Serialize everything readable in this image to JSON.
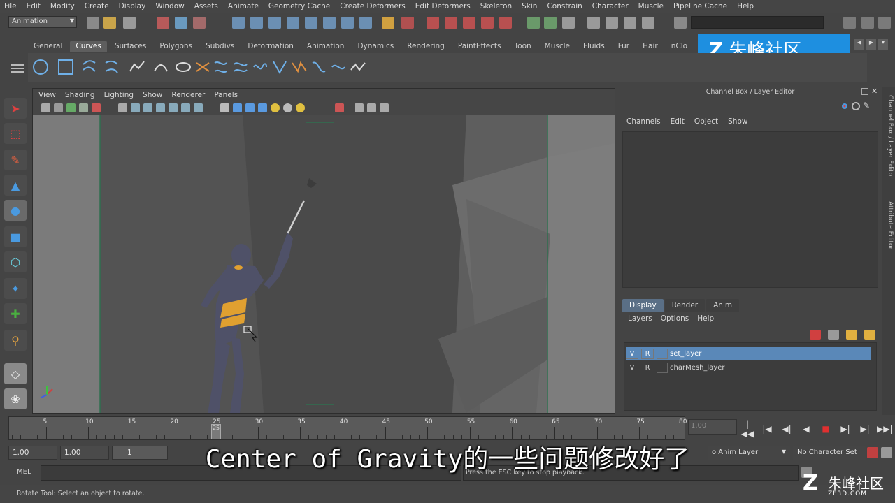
{
  "menu": [
    "File",
    "Edit",
    "Modify",
    "Create",
    "Display",
    "Window",
    "Assets",
    "Animate",
    "Geometry Cache",
    "Create Deformers",
    "Edit Deformers",
    "Skeleton",
    "Skin",
    "Constrain",
    "Character",
    "Muscle",
    "Pipeline Cache",
    "Help"
  ],
  "statusline": {
    "mode": "Animation"
  },
  "shelf_tabs": [
    "General",
    "Curves",
    "Surfaces",
    "Polygons",
    "Subdivs",
    "Deformation",
    "Animation",
    "Dynamics",
    "Rendering",
    "PaintEffects",
    "Toon",
    "Muscle",
    "Fluids",
    "Fur",
    "Hair",
    "nClo"
  ],
  "shelf_active": "Curves",
  "viewport_menu": [
    "View",
    "Shading",
    "Lighting",
    "Show",
    "Renderer",
    "Panels"
  ],
  "channel_box": {
    "title": "Channel Box / Layer Editor",
    "menu": [
      "Channels",
      "Edit",
      "Object",
      "Show"
    ],
    "layer_tabs": [
      "Display",
      "Render",
      "Anim"
    ],
    "layer_menu": [
      "Layers",
      "Options",
      "Help"
    ],
    "layers": [
      {
        "v": "V",
        "r": "R",
        "name": "set_layer",
        "selected": true
      },
      {
        "v": "V",
        "r": "R",
        "name": "charMesh_layer",
        "selected": false
      }
    ]
  },
  "side_tabs": [
    "Channel Box / Layer Editor",
    "Attribute Editor"
  ],
  "timeline": {
    "ticks": [
      "5",
      "10",
      "15",
      "20",
      "25",
      "30",
      "35",
      "40",
      "45",
      "50",
      "55",
      "60",
      "65",
      "70",
      "75",
      "80"
    ],
    "current": "25",
    "current_field": "1.00"
  },
  "range": {
    "start": "1.00",
    "start2": "1.00",
    "slider_start": "1",
    "anim_layer": "o Anim Layer",
    "character_set": "No Character Set"
  },
  "command": {
    "label": "MEL",
    "result": "Press the ESC key to stop playback."
  },
  "help_line": "Rotate Tool: Select an object to rotate.",
  "subtitle": "Center of Gravity的一些问题修改好了",
  "watermark": {
    "name": "朱峰社区",
    "url": "ZF3D.COM"
  },
  "colors": {
    "accent": "#1e8fe0",
    "selected_layer": "#5a88b8",
    "character_band": "#e0a030",
    "character_body": "#4f5168"
  }
}
